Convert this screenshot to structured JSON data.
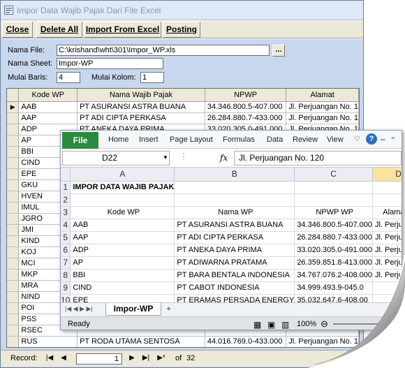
{
  "access": {
    "title": "Impor Data Wajib Pajak Dari File Excel",
    "toolbar": {
      "close": "Close",
      "delete_all": "Delete All",
      "import": "Import From Excel",
      "posting": "Posting"
    },
    "form": {
      "nama_file_label": "Nama File:",
      "nama_file_value": "C:\\krishand\\wht\\301\\Impor_WP.xls",
      "browse": "...",
      "nama_sheet_label": "Nama Sheet:",
      "nama_sheet_value": "Impor-WP",
      "mulai_baris_label": "Mulai Baris:",
      "mulai_baris_value": "4",
      "mulai_kolom_label": "Mulai Kolom:",
      "mulai_kolom_value": "1"
    },
    "datasheet": {
      "headers": [
        "Kode WP",
        "Nama Wajib Pajak",
        "NPWP",
        "Alamat"
      ],
      "rows": [
        [
          "AAB",
          "PT ASURANSI ASTRA BUANA",
          "34.346.800.5-407.000",
          "Jl. Perjuangan No. 1"
        ],
        [
          "AAP",
          "PT ADI CIPTA PERKASA",
          "26.284.880.7-433.000",
          "Jl. Perjuangan No. 1"
        ],
        [
          "ADP",
          "PT ANEKA DAYA PRIMA",
          "33.020.305.0-491.000",
          "Jl. Perjuangan No. 1"
        ],
        [
          "AP",
          "",
          "",
          ""
        ],
        [
          "BBI",
          "",
          "",
          ""
        ],
        [
          "CIND",
          "",
          "",
          ""
        ],
        [
          "EPE",
          "",
          "",
          ""
        ],
        [
          "GKU",
          "",
          "",
          ""
        ],
        [
          "HVEN",
          "",
          "",
          ""
        ],
        [
          "IMUL",
          "",
          "",
          ""
        ],
        [
          "JGRO",
          "",
          "",
          ""
        ],
        [
          "JMI",
          "",
          "",
          ""
        ],
        [
          "KIND",
          "",
          "",
          ""
        ],
        [
          "KOJ",
          "",
          "",
          ""
        ],
        [
          "MCI",
          "",
          "",
          ""
        ],
        [
          "MKP",
          "",
          "",
          ""
        ],
        [
          "MRA",
          "",
          "",
          ""
        ],
        [
          "NIND",
          "",
          "",
          ""
        ],
        [
          "POI",
          "",
          "",
          ""
        ],
        [
          "PSS",
          "",
          "",
          ""
        ],
        [
          "RSEC",
          "",
          "",
          ""
        ],
        [
          "RUS",
          "PT RODA UTAMA SENTOSA",
          "44.016.769.0-433.000",
          "Jl. Perjuangan No. 1"
        ],
        [
          "",
          "",
          "",
          ""
        ]
      ]
    },
    "nav": {
      "record_label": "Record:",
      "current": "1",
      "of_label": "of",
      "total": "32"
    }
  },
  "excel": {
    "ribbon": {
      "file": "File",
      "tabs": [
        "Home",
        "Insert",
        "Page Layout",
        "Formulas",
        "Data",
        "Review",
        "View"
      ]
    },
    "name_box": "D22",
    "fx": "fx",
    "formula": "Jl. Perjuangan No. 120",
    "columns": [
      "A",
      "B",
      "C",
      "D"
    ],
    "rows": [
      {
        "n": "1",
        "a": "IMPOR DATA WAJIB PAJAK",
        "b": "",
        "c": "",
        "d": ""
      },
      {
        "n": "2",
        "a": "",
        "b": "",
        "c": "",
        "d": ""
      },
      {
        "n": "3",
        "a": "Kode WP",
        "b": "Nama WP",
        "c": "NPWP WP",
        "d": "Alamat W"
      },
      {
        "n": "4",
        "a": "AAB",
        "b": "PT ASURANSI ASTRA BUANA",
        "c": "34.346.800.5-407.000",
        "d": "Jl. Perjuangan"
      },
      {
        "n": "5",
        "a": "AAP",
        "b": "PT ADI CIPTA PERKASA",
        "c": "26.284.880.7-433.000",
        "d": "Jl. Perjuangan"
      },
      {
        "n": "6",
        "a": "ADP",
        "b": "PT ANEKA DAYA PRIMA",
        "c": "33.020.305.0-491.000",
        "d": "Jl. Perjuangan"
      },
      {
        "n": "7",
        "a": "AP",
        "b": "PT ADIWARNA PRATAMA",
        "c": "26.359.851.8-413.000",
        "d": "Jl. Perjuangan"
      },
      {
        "n": "8",
        "a": "BBI",
        "b": "PT BARA BENTALA INDONESIA",
        "c": "34.767.076.2-408.000",
        "d": "Jl. Perjuangan"
      },
      {
        "n": "9",
        "a": "CIND",
        "b": "PT CABOT INDONESIA",
        "c": "34.999.493.9-045.0",
        "d": ""
      },
      {
        "n": "10",
        "a": "EPE",
        "b": "PT ERAMAS PERSADA ENERGY",
        "c": "35.032.647.6-408.00",
        "d": ""
      }
    ],
    "sheet_tab": "Impor-WP",
    "status": "Ready",
    "zoom": "100%"
  }
}
